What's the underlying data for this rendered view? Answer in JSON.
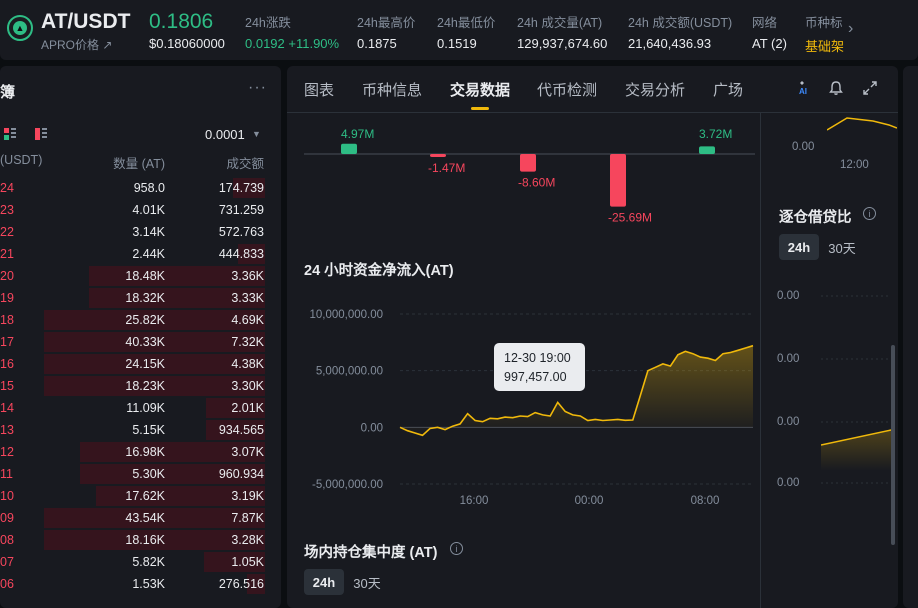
{
  "ticker": {
    "pair": "AT/USDT",
    "subtitle": "APRO价格 ↗",
    "last_price": "0.1806",
    "last_usd": "$0.18060000",
    "stats": [
      {
        "label": "24h涨跌",
        "value": "0.0192 +11.90%",
        "kind": "up"
      },
      {
        "label": "24h最高价",
        "value": "0.1875",
        "kind": "plain"
      },
      {
        "label": "24h最低价",
        "value": "0.1519",
        "kind": "plain"
      },
      {
        "label": "24h 成交量(AT)",
        "value": "129,937,674.60",
        "kind": "plain"
      },
      {
        "label": "24h 成交额(USDT)",
        "value": "21,640,436.93",
        "kind": "plain"
      },
      {
        "label": "网络",
        "value": "AT (2)",
        "kind": "plain"
      },
      {
        "label": "币种标",
        "value": "基础架",
        "kind": "tag"
      }
    ]
  },
  "book": {
    "title": "簿",
    "more": "···",
    "tick": "0.0001",
    "headers": {
      "price": "(USDT)",
      "qty": "数量 (AT)",
      "total": "成交额"
    },
    "rows": [
      {
        "p": "24",
        "q": "958.0",
        "t": "174.739",
        "d": 0.14
      },
      {
        "p": "23",
        "q": "4.01K",
        "t": "731.259",
        "d": 0.0
      },
      {
        "p": "22",
        "q": "3.14K",
        "t": "572.763",
        "d": 0.0
      },
      {
        "p": "21",
        "q": "2.44K",
        "t": "444.833",
        "d": 0.12
      },
      {
        "p": "20",
        "q": "18.48K",
        "t": "3.36K",
        "d": 0.78
      },
      {
        "p": "19",
        "q": "18.32K",
        "t": "3.33K",
        "d": 0.78
      },
      {
        "p": "18",
        "q": "25.82K",
        "t": "4.69K",
        "d": 0.98
      },
      {
        "p": "17",
        "q": "40.33K",
        "t": "7.32K",
        "d": 0.98
      },
      {
        "p": "16",
        "q": "24.15K",
        "t": "4.38K",
        "d": 0.98
      },
      {
        "p": "15",
        "q": "18.23K",
        "t": "3.30K",
        "d": 0.98
      },
      {
        "p": "14",
        "q": "11.09K",
        "t": "2.01K",
        "d": 0.26
      },
      {
        "p": "13",
        "q": "5.15K",
        "t": "934.565",
        "d": 0.26
      },
      {
        "p": "12",
        "q": "16.98K",
        "t": "3.07K",
        "d": 0.82
      },
      {
        "p": "11",
        "q": "5.30K",
        "t": "960.934",
        "d": 0.82
      },
      {
        "p": "10",
        "q": "17.62K",
        "t": "3.19K",
        "d": 0.75
      },
      {
        "p": "09",
        "q": "43.54K",
        "t": "7.87K",
        "d": 0.98
      },
      {
        "p": "08",
        "q": "18.16K",
        "t": "3.28K",
        "d": 0.98
      },
      {
        "p": "07",
        "q": "5.82K",
        "t": "1.05K",
        "d": 0.27
      },
      {
        "p": "06",
        "q": "1.53K",
        "t": "276.516",
        "d": 0.08
      }
    ]
  },
  "tabs": [
    {
      "label": "图表",
      "active": false
    },
    {
      "label": "币种信息",
      "active": false
    },
    {
      "label": "交易数据",
      "active": true
    },
    {
      "label": "代币检测",
      "active": false
    },
    {
      "label": "交易分析",
      "active": false
    },
    {
      "label": "广场",
      "active": false
    }
  ],
  "bars": [
    {
      "value": 4.97,
      "label": "4.97M"
    },
    {
      "value": -1.47,
      "label": "-1.47M"
    },
    {
      "value": -8.6,
      "label": "-8.60M"
    },
    {
      "value": -25.69,
      "label": "-25.69M"
    },
    {
      "value": 3.72,
      "label": "3.72M"
    }
  ],
  "netflow": {
    "title": "24 小时资金净流入(AT)",
    "tooltip_time": "12-30 19:00",
    "tooltip_value": "997,457.00"
  },
  "concentration": {
    "title": "场内持仓集中度 (AT)",
    "pill_on": "24h",
    "pill_off": "30天"
  },
  "ratio": {
    "title": "逐仓借贷比",
    "pill_on": "24h",
    "pill_off": "30天",
    "yticks": [
      "0.00",
      "0.00",
      "0.00",
      "0.00"
    ],
    "top_tick": "0.00",
    "top_time": "12:00"
  },
  "chart_data": {
    "type": "area",
    "title": "24 小时资金净流入(AT)",
    "xlabel": "",
    "ylabel": "",
    "x_ticks": [
      "16:00",
      "00:00",
      "08:00"
    ],
    "y_ticks": [
      "10,000,000.00",
      "5,000,000.00",
      "0.00",
      "-5,000,000.00"
    ],
    "ylim": [
      -5000000,
      10000000
    ],
    "color": "#f0b90b",
    "x": [
      0,
      1,
      2,
      3,
      4,
      5,
      6,
      7,
      8,
      9,
      10,
      11,
      12,
      13,
      14,
      15,
      16,
      17,
      18,
      19,
      20,
      21,
      22,
      23,
      24,
      25,
      26,
      27,
      28,
      29,
      30,
      31,
      32,
      33,
      34,
      35,
      36,
      37,
      38,
      39,
      40,
      41,
      42,
      43,
      44,
      45,
      46,
      47
    ],
    "values": [
      0,
      -300000,
      -500000,
      -700000,
      -100000,
      0,
      -200000,
      100000,
      300000,
      1200000,
      600000,
      500000,
      800000,
      750000,
      900000,
      850000,
      1000000,
      950000,
      1300000,
      1100000,
      1000000,
      2200000,
      1400000,
      1100000,
      997457,
      600000,
      700000,
      600000,
      650000,
      700000,
      620000,
      650000,
      2800000,
      5000000,
      5300000,
      5600000,
      5400000,
      6400000,
      6700000,
      6500000,
      6200000,
      6100000,
      5900000,
      6500000,
      6600000,
      6800000,
      7000000,
      7200000
    ]
  }
}
